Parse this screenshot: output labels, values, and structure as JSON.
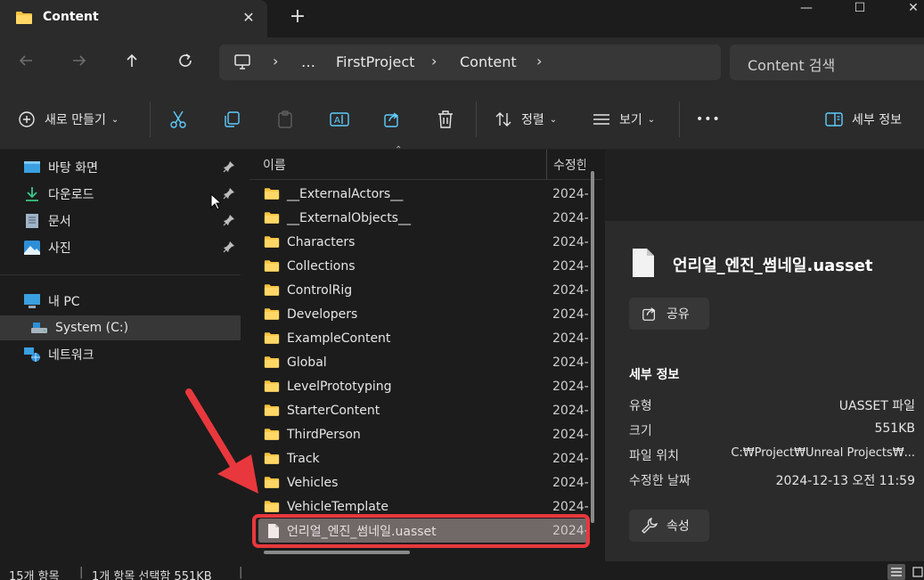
{
  "window": {
    "tab_title": "Content",
    "tab_close": "✕",
    "new_tab": "+",
    "minimize": "—",
    "maximize": "☐",
    "close": "✕"
  },
  "nav": {
    "breadcrumb": [
      "…",
      "FirstProject",
      "Content"
    ],
    "search_placeholder": "Content 검색"
  },
  "toolbar": {
    "new_label": "새로 만들기",
    "sort_label": "정렬",
    "view_label": "보기",
    "more_label": "•••",
    "details_label": "세부 정보"
  },
  "sidebar": {
    "quick_access": [
      {
        "label": "바탕 화면"
      },
      {
        "label": "다운로드"
      },
      {
        "label": "문서"
      },
      {
        "label": "사진"
      }
    ],
    "this_pc": "내 PC",
    "system_drive": "System (C:)",
    "network": "네트워크"
  },
  "filelist": {
    "col_name": "이름",
    "col_modified": "수정한",
    "rows": [
      {
        "name": "__ExternalActors__",
        "date": "2024-"
      },
      {
        "name": "__ExternalObjects__",
        "date": "2024-"
      },
      {
        "name": "Characters",
        "date": "2024-"
      },
      {
        "name": "Collections",
        "date": "2024-"
      },
      {
        "name": "ControlRig",
        "date": "2024-"
      },
      {
        "name": "Developers",
        "date": "2024-"
      },
      {
        "name": "ExampleContent",
        "date": "2024-"
      },
      {
        "name": "Global",
        "date": "2024-"
      },
      {
        "name": "LevelPrototyping",
        "date": "2024-"
      },
      {
        "name": "StarterContent",
        "date": "2024-"
      },
      {
        "name": "ThirdPerson",
        "date": "2024-"
      },
      {
        "name": "Track",
        "date": "2024-"
      },
      {
        "name": "Vehicles",
        "date": "2024-"
      },
      {
        "name": "VehicleTemplate",
        "date": "2024-"
      }
    ],
    "selected_file": {
      "name": "언리얼_엔진_썸네일.uasset",
      "date": "2024-"
    }
  },
  "details": {
    "file_name": "언리얼_엔진_썸네일.uasset",
    "share_label": "공유",
    "section_title": "세부 정보",
    "type_label": "유형",
    "type_value": "UASSET 파일",
    "size_label": "크기",
    "size_value": "551KB",
    "location_label": "파일 위치",
    "location_value": "C:₩Project₩Unreal Projects₩...",
    "modified_label": "수정한 날짜",
    "modified_value": "2024-12-13 오전 11:59",
    "properties_label": "속성"
  },
  "status": {
    "item_count": "15개 항목",
    "selection": "1개 항목 선택함 551KB"
  },
  "colors": {
    "folder": "#f5c242",
    "accent": "#60cdff",
    "annotation": "#e8383d"
  }
}
